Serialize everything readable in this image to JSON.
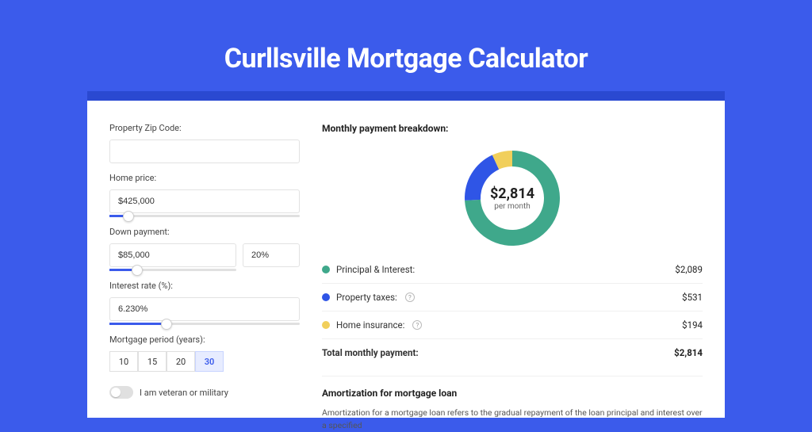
{
  "title": "Curllsville Mortgage Calculator",
  "form": {
    "zip_label": "Property Zip Code:",
    "zip_value": "",
    "home_price_label": "Home price:",
    "home_price_value": "$425,000",
    "home_price_slider_pct": 10,
    "down_label": "Down payment:",
    "down_value": "$85,000",
    "down_pct_value": "20%",
    "down_slider_pct": 22,
    "rate_label": "Interest rate (%):",
    "rate_value": "6.230%",
    "rate_slider_pct": 30,
    "period_label": "Mortgage period (years):",
    "periods": [
      "10",
      "15",
      "20",
      "30"
    ],
    "period_active_index": 3,
    "veteran_label": "I am veteran or military"
  },
  "breakdown": {
    "section_title": "Monthly payment breakdown:",
    "center_amount": "$2,814",
    "center_sub": "per month",
    "items": [
      {
        "label": "Principal & Interest:",
        "value": "$2,089",
        "color": "#3fa88b",
        "info": false
      },
      {
        "label": "Property taxes:",
        "value": "$531",
        "color": "#2f55e6",
        "info": true
      },
      {
        "label": "Home insurance:",
        "value": "$194",
        "color": "#f1cf5b",
        "info": true
      }
    ],
    "total_label": "Total monthly payment:",
    "total_value": "$2,814"
  },
  "amortization": {
    "title": "Amortization for mortgage loan",
    "text": "Amortization for a mortgage loan refers to the gradual repayment of the loan principal and interest over a specified"
  },
  "chart_data": {
    "type": "pie",
    "title": "Monthly payment breakdown",
    "series": [
      {
        "name": "Principal & Interest",
        "value": 2089,
        "color": "#3fa88b"
      },
      {
        "name": "Property taxes",
        "value": 531,
        "color": "#2f55e6"
      },
      {
        "name": "Home insurance",
        "value": 194,
        "color": "#f1cf5b"
      }
    ],
    "total": 2814,
    "units": "USD per month"
  }
}
